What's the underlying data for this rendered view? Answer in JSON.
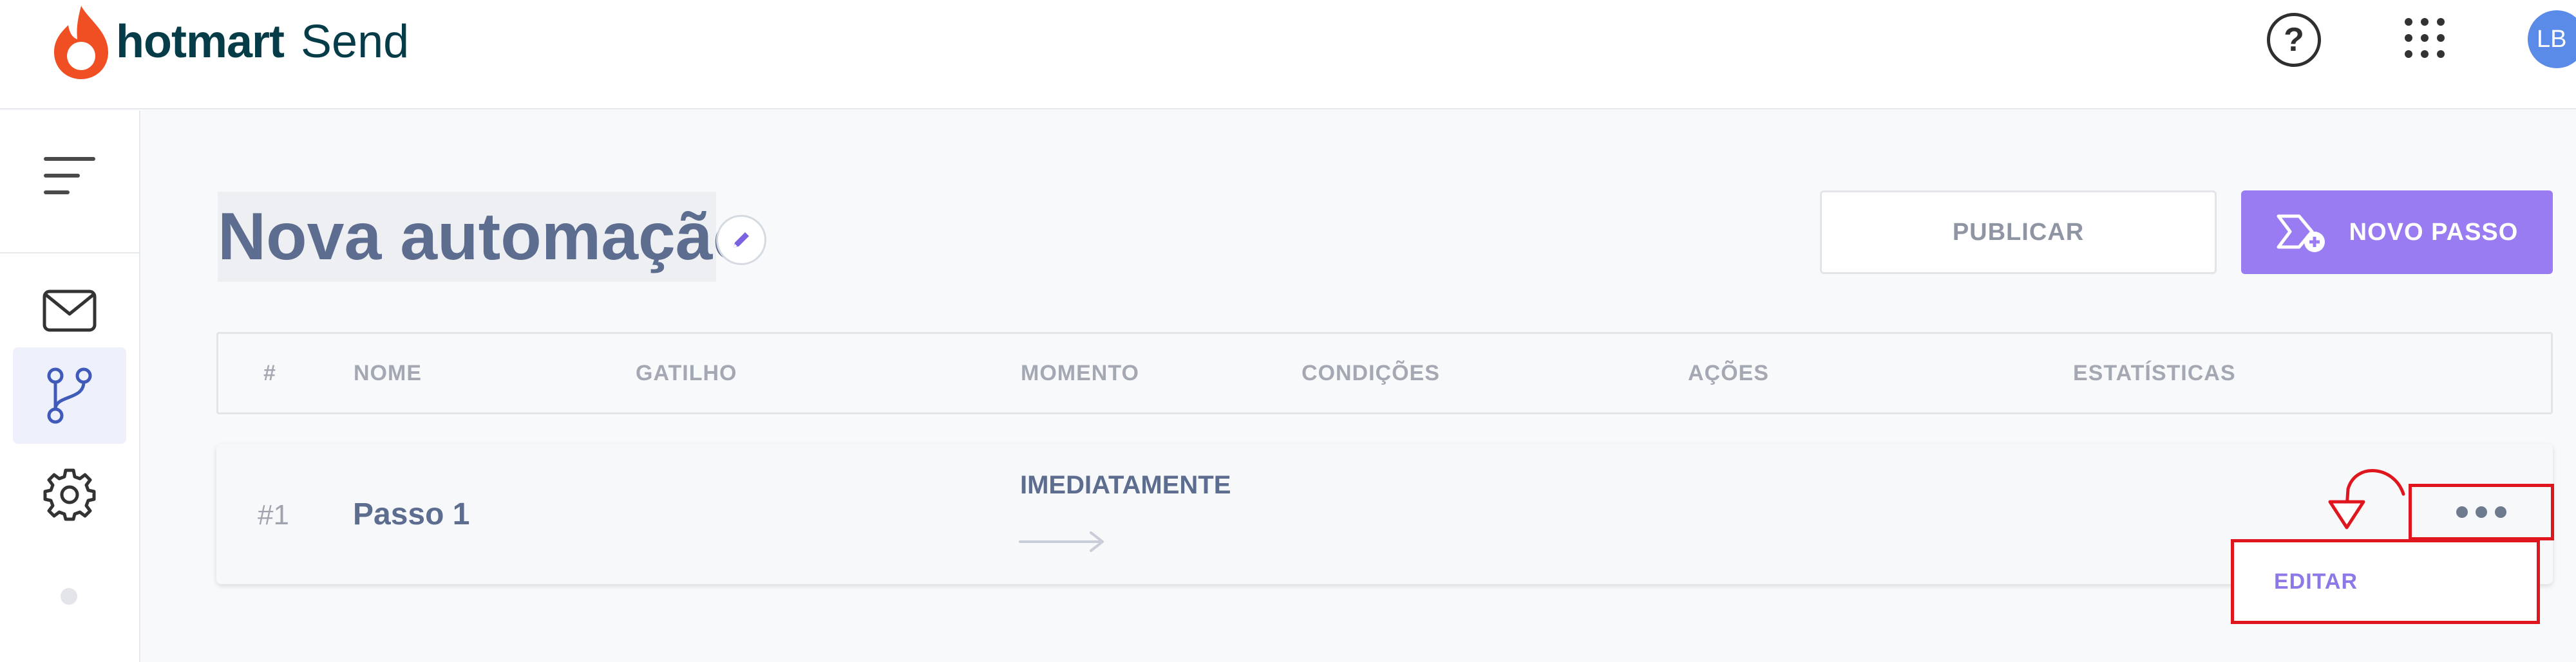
{
  "header": {
    "brand": "hotmart",
    "product": "Send",
    "help_label": "?",
    "avatar_initials": "LB"
  },
  "sidebar": {
    "items": [
      {
        "icon": "mail-icon"
      },
      {
        "icon": "automation-branch-icon",
        "active": true
      },
      {
        "icon": "gear-icon"
      }
    ]
  },
  "main": {
    "title": "Nova automação",
    "publish_label": "PUBLICAR",
    "new_step_label": "NOVO PASSO"
  },
  "table": {
    "headers": [
      "#",
      "NOME",
      "GATILHO",
      "MOMENTO",
      "CONDIÇÕES",
      "AÇÕES",
      "ESTATÍSTICAS"
    ],
    "rows": [
      {
        "num": "#1",
        "name": "Passo 1",
        "moment": "IMEDIATAMENTE"
      }
    ]
  },
  "row_menu": {
    "edit_label": "EDITAR"
  },
  "colors": {
    "accent": "#9a7cf2",
    "highlight": "#e0161e",
    "brand_flame": "#f04e23"
  }
}
